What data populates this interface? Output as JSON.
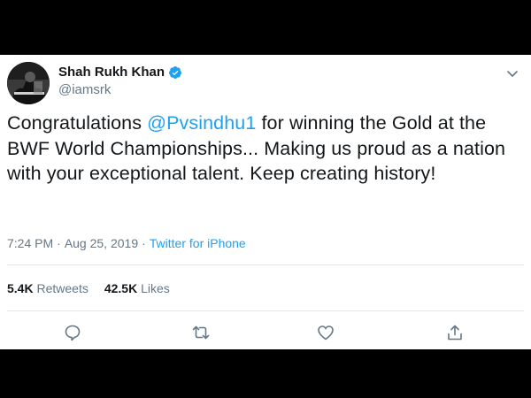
{
  "tweet": {
    "author": {
      "name": "Shah Rukh Khan",
      "handle": "@iamsrk",
      "verified": true
    },
    "text": {
      "before": "Congratulations ",
      "mention": "@Pvsindhu1",
      "after": " for winning the Gold at the BWF World Championships... Making us proud as a nation with your exceptional talent. Keep creating history!"
    },
    "time": "7:24 PM",
    "separator": "·",
    "date": "Aug 25, 2019",
    "source": "Twitter for iPhone",
    "retweets_count": "5.4K",
    "retweets_label": "Retweets",
    "likes_count": "42.5K",
    "likes_label": "Likes"
  },
  "icons": {
    "verified": "verified-badge-icon",
    "caret": "chevron-down-icon",
    "reply": "reply-icon",
    "retweet": "retweet-icon",
    "like": "heart-icon",
    "share": "share-icon"
  },
  "colors": {
    "accent": "#1da1f2",
    "text": "#14171a",
    "muted": "#657786",
    "divider": "#e1e8ed",
    "letterbox": "#000000"
  }
}
